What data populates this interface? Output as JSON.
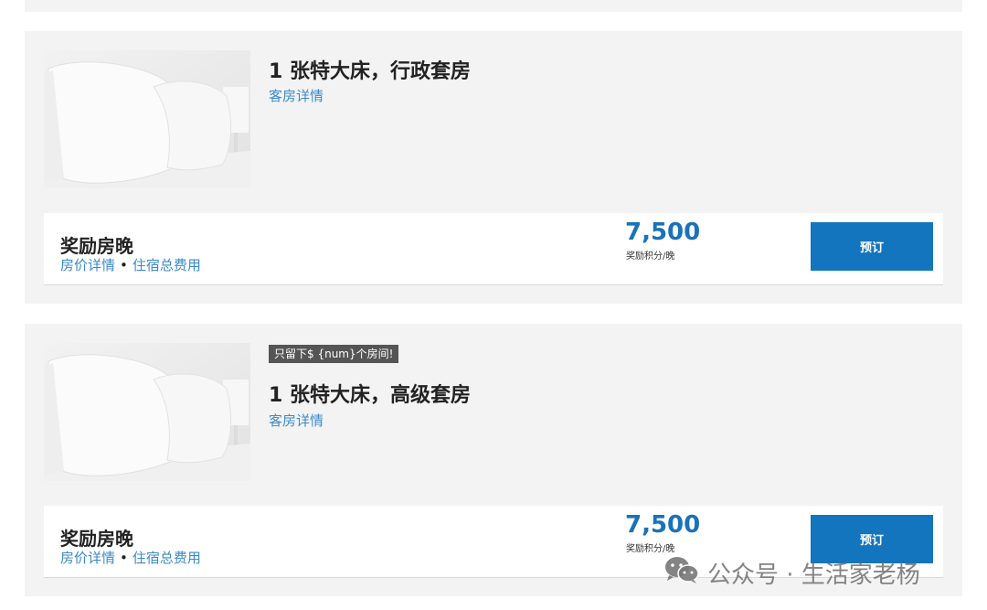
{
  "rooms": [
    {
      "title": "1 张特大床，行政套房",
      "details_link": "客房详情",
      "rate": {
        "name": "奖励房晚",
        "price_details_link": "房价详情",
        "separator": "•",
        "total_cost_link": "住宿总费用",
        "points": "7,500",
        "points_unit": "奖励积分/晚",
        "book_label": "预订"
      }
    },
    {
      "badge": "只留下$ {num}个房间!",
      "title": "1 张特大床，高级套房",
      "details_link": "客房详情",
      "rate": {
        "name": "奖励房晚",
        "price_details_link": "房价详情",
        "separator": "•",
        "total_cost_link": "住宿总费用",
        "points": "7,500",
        "points_unit": "奖励积分/晚",
        "book_label": "预订"
      }
    }
  ],
  "watermark": {
    "icon": "wechat-icon",
    "text": "公众号 · 生活家老杨"
  },
  "colors": {
    "card_bg": "#f3f3f3",
    "link": "#3b8ac9",
    "points": "#1a72b8",
    "button": "#1375bd",
    "badge": "#555555"
  }
}
